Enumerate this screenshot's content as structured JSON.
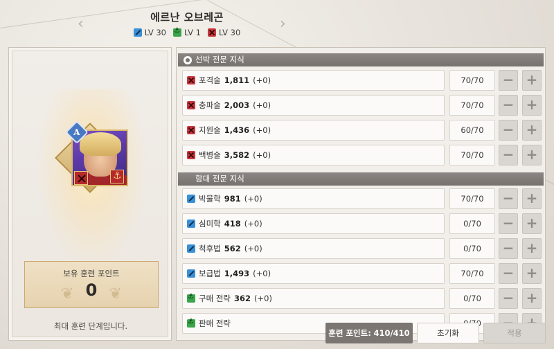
{
  "header": {
    "title": "에르난 오브레곤",
    "levels": [
      {
        "icon": "blue",
        "label": "LV 30"
      },
      {
        "icon": "green",
        "label": "LV 1"
      },
      {
        "icon": "red",
        "label": "LV 30"
      }
    ]
  },
  "left": {
    "rank_letter": "A",
    "points_label": "보유 훈련 포인트",
    "points_value": "0",
    "max_message": "최대 훈련 단계입니다."
  },
  "sections": [
    {
      "title": "선박 전문 지식",
      "skills": [
        {
          "icon": "red",
          "name": "포격술",
          "value": "1,811",
          "bonus": "(+0)",
          "level": "70/70"
        },
        {
          "icon": "red",
          "name": "충파술",
          "value": "2,003",
          "bonus": "(+0)",
          "level": "70/70"
        },
        {
          "icon": "red",
          "name": "지원술",
          "value": "1,436",
          "bonus": "(+0)",
          "level": "60/70"
        },
        {
          "icon": "red",
          "name": "백병술",
          "value": "3,582",
          "bonus": "(+0)",
          "level": "70/70"
        }
      ]
    },
    {
      "title": "함대 전문 지식",
      "skills": [
        {
          "icon": "blue",
          "name": "박물학",
          "value": "981",
          "bonus": "(+0)",
          "level": "70/70"
        },
        {
          "icon": "blue",
          "name": "심미학",
          "value": "418",
          "bonus": "(+0)",
          "level": "0/70"
        },
        {
          "icon": "blue",
          "name": "척후법",
          "value": "562",
          "bonus": "(+0)",
          "level": "0/70"
        },
        {
          "icon": "blue",
          "name": "보급법",
          "value": "1,493",
          "bonus": "(+0)",
          "level": "70/70"
        },
        {
          "icon": "green",
          "name": "구매 전략",
          "value": "362",
          "bonus": "(+0)",
          "level": "0/70"
        },
        {
          "icon": "green",
          "name": "판매 전략",
          "value": "",
          "bonus": "",
          "level": "0/70"
        }
      ]
    }
  ],
  "buttons": {
    "minus": "−",
    "plus": "+"
  },
  "bottom": {
    "training_points_label": "훈련 포인트:",
    "training_points_value": "410/410",
    "reset": "초기화",
    "apply": "적용"
  }
}
